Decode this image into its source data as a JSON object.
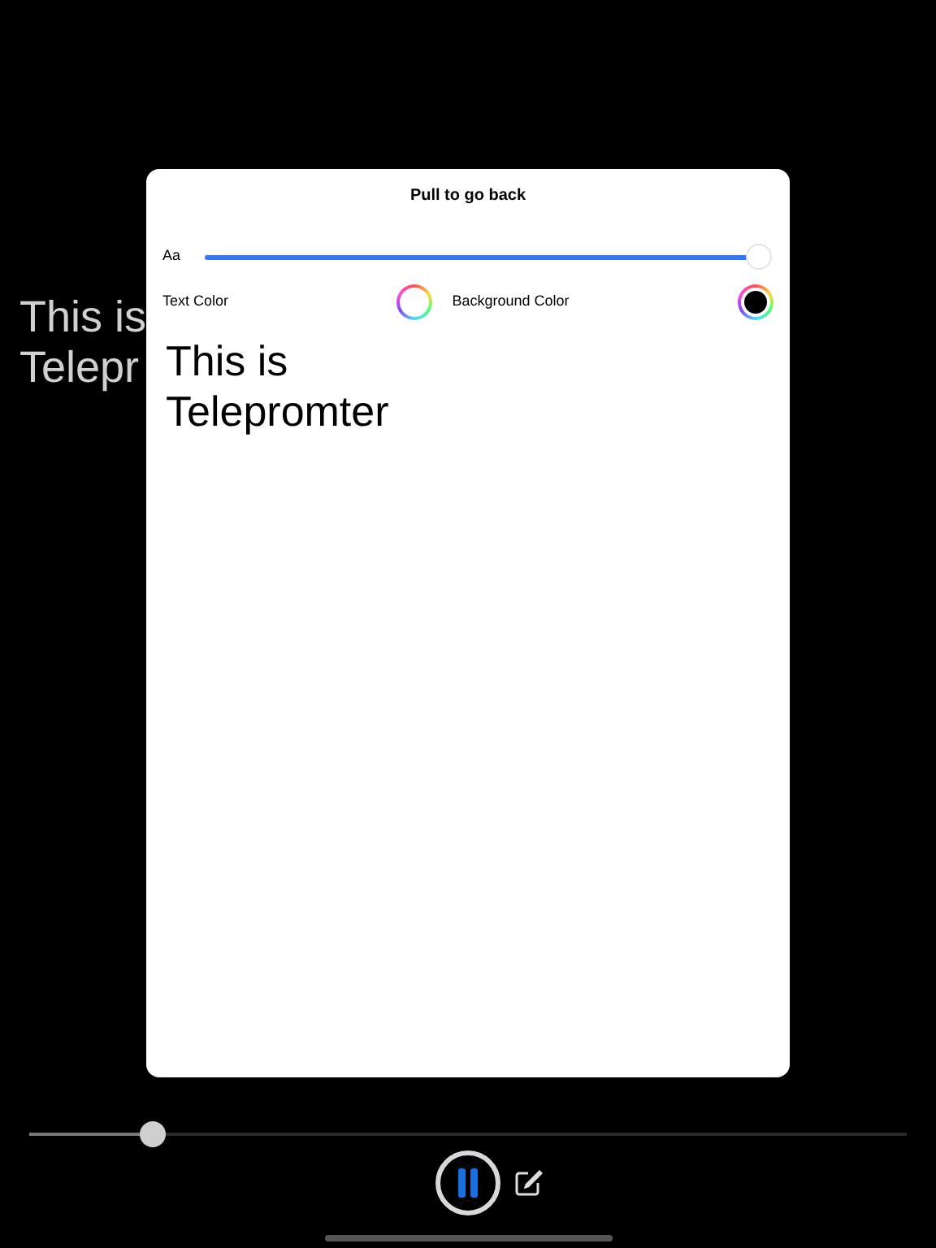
{
  "background_text": [
    "This is",
    "Telepr"
  ],
  "sheet": {
    "title": "Pull to go back",
    "font_size_label": "Aa",
    "font_size": {
      "level": 1
    },
    "text_color": {
      "label": "Text Color",
      "color": "#ffffff"
    },
    "background_color": {
      "label": "Background Color",
      "color": "#000000"
    },
    "preview": [
      "This is",
      "Telepromter"
    ]
  },
  "playback": {
    "level": 0.14,
    "playing": true
  }
}
